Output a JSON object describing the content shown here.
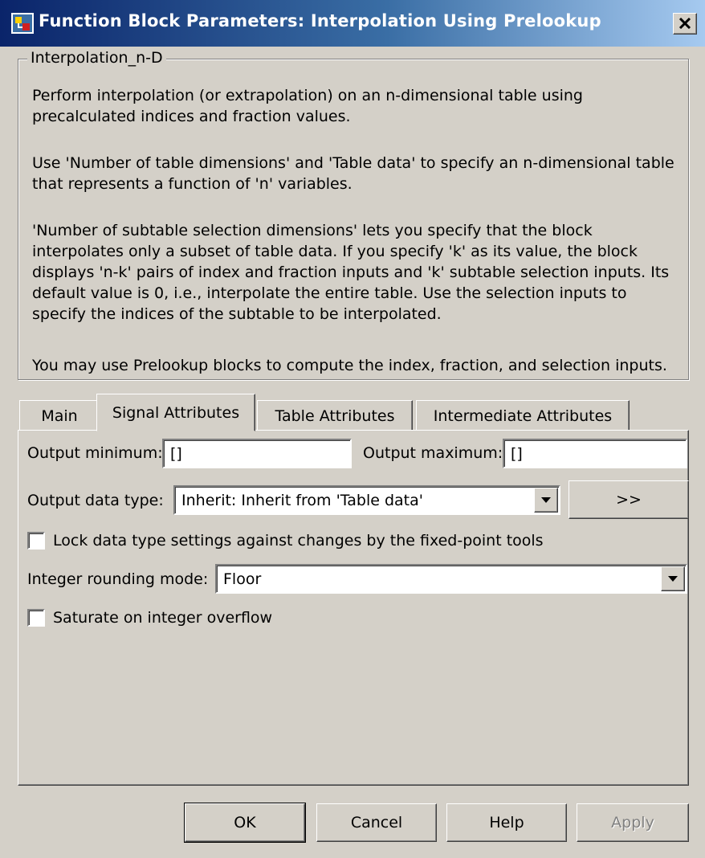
{
  "window": {
    "title": "Function Block Parameters: Interpolation Using Prelookup",
    "close_glyph": "✕"
  },
  "description": {
    "group_label": "Interpolation_n-D",
    "paragraphs": [
      [
        "Perform interpolation (or extrapolation) on an n-dimensional table using",
        "precalculated indices and fraction values."
      ],
      [
        "Use 'Number of table dimensions' and 'Table data' to specify an n-dimensional table",
        "that represents a function of 'n' variables."
      ],
      [
        "'Number of subtable selection dimensions' lets you specify that the block",
        "interpolates only a subset of table data. If you specify 'k' as its value, the block",
        "displays 'n-k' pairs of index and fraction inputs and 'k' subtable selection inputs. Its",
        "default value is 0, i.e., interpolate the entire table. Use the selection inputs to",
        "specify the indices of the subtable to be interpolated."
      ],
      [
        "You may use Prelookup blocks to compute the index, fraction, and selection inputs."
      ]
    ]
  },
  "tabs": [
    {
      "label": "Main",
      "active": false
    },
    {
      "label": "Signal Attributes",
      "active": true
    },
    {
      "label": "Table Attributes",
      "active": false
    },
    {
      "label": "Intermediate Attributes",
      "active": false
    }
  ],
  "signal_attributes": {
    "output_minimum_label": "Output minimum:",
    "output_minimum_value": "[]",
    "output_maximum_label": "Output maximum:",
    "output_maximum_value": "[]",
    "output_data_type_label": "Output data type:",
    "output_data_type_value": "Inherit: Inherit from 'Table data'",
    "assistant_button_label": ">>",
    "lock_label": "Lock data type settings against changes by the fixed-point tools",
    "lock_checked": false,
    "rounding_label": "Integer rounding mode:",
    "rounding_value": "Floor",
    "saturate_label": "Saturate on integer overflow",
    "saturate_checked": false
  },
  "buttons": {
    "ok": "OK",
    "cancel": "Cancel",
    "help": "Help",
    "apply": "Apply"
  },
  "colors": {
    "dialog_bg": "#d4d0c8",
    "title_bar_start": "#0a246a",
    "title_bar_end": "#a6caf0",
    "disabled_text": "#808080"
  }
}
